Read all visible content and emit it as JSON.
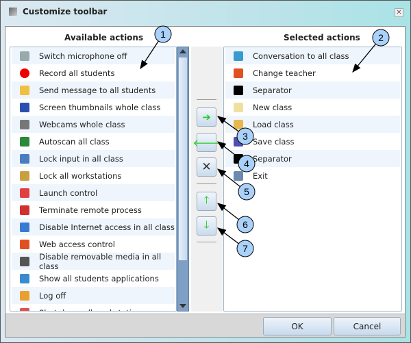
{
  "window": {
    "title": "Customize toolbar",
    "close": "✕"
  },
  "available": {
    "header": "Available actions",
    "items": [
      {
        "label": "Switch microphone off",
        "icon": "microphone-off-icon",
        "color": "#9aa"
      },
      {
        "label": "Record all students",
        "icon": "record-icon",
        "color": "#e00"
      },
      {
        "label": "Send message to all students",
        "icon": "message-icon",
        "color": "#f0c040"
      },
      {
        "label": "Screen thumbnails whole class",
        "icon": "monitor-icon",
        "color": "#2a4fb0"
      },
      {
        "label": "Webcams whole class",
        "icon": "webcam-icon",
        "color": "#777"
      },
      {
        "label": "Autoscan all class",
        "icon": "autoscan-icon",
        "color": "#2a8a3a"
      },
      {
        "label": "Lock input in all class",
        "icon": "lock-input-icon",
        "color": "#4a7cc0"
      },
      {
        "label": "Lock all workstations",
        "icon": "lock-icon",
        "color": "#c9a040"
      },
      {
        "label": "Launch control",
        "icon": "launch-icon",
        "color": "#e04040"
      },
      {
        "label": "Terminate remote process",
        "icon": "terminate-icon",
        "color": "#d03030"
      },
      {
        "label": "Disable Internet access in all class",
        "icon": "internet-off-icon",
        "color": "#3a7ad0"
      },
      {
        "label": "Web access control",
        "icon": "web-icon",
        "color": "#e05020"
      },
      {
        "label": "Disable removable media in all class",
        "icon": "usb-off-icon",
        "color": "#555"
      },
      {
        "label": "Show all students applications",
        "icon": "applications-icon",
        "color": "#3a8ad0"
      },
      {
        "label": "Log off",
        "icon": "logoff-icon",
        "color": "#e8a030"
      },
      {
        "label": "Shut down all workstations",
        "icon": "shutdown-icon",
        "color": "#e05050"
      }
    ]
  },
  "selected": {
    "header": "Selected actions",
    "items": [
      {
        "label": "Conversation to all class",
        "icon": "conversation-icon",
        "color": "#3a9ad0"
      },
      {
        "label": "Change teacher",
        "icon": "change-teacher-icon",
        "color": "#e05020"
      },
      {
        "label": "Separator",
        "icon": "separator-icon",
        "color": "#000"
      },
      {
        "label": "New class",
        "icon": "new-class-icon",
        "color": "#f0e0a0"
      },
      {
        "label": "Load class",
        "icon": "folder-icon",
        "color": "#e8b850"
      },
      {
        "label": "Save class",
        "icon": "save-icon",
        "color": "#5050b0"
      },
      {
        "label": "Separator",
        "icon": "separator-icon",
        "color": "#000"
      },
      {
        "label": "Exit",
        "icon": "exit-icon",
        "color": "#6a8ab0"
      }
    ]
  },
  "buttons": {
    "add": "➔",
    "remove": "🡐",
    "delete": "✕",
    "up": "🡑",
    "down": "🡓",
    "ok": "OK",
    "cancel": "Cancel"
  },
  "callouts": [
    "1",
    "2",
    "3",
    "4",
    "5",
    "6",
    "7"
  ]
}
